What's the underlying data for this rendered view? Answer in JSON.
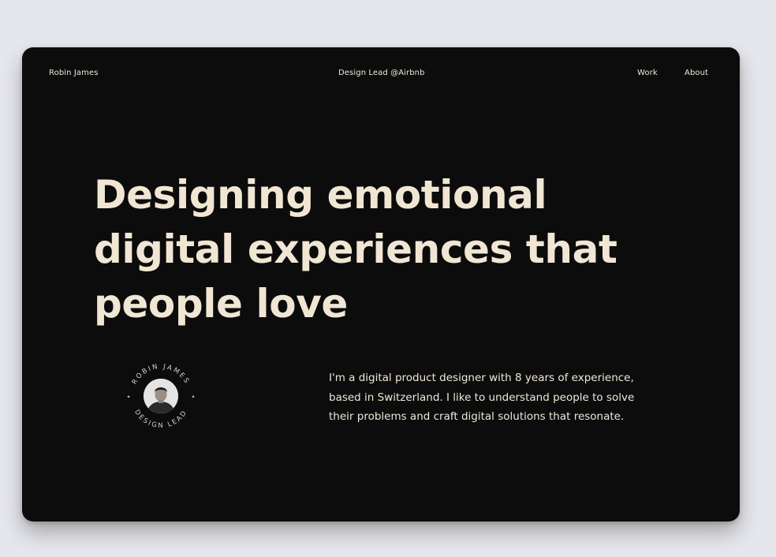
{
  "header": {
    "brand": "Robin James",
    "role": "Design Lead @Airbnb",
    "nav": [
      {
        "label": "Work"
      },
      {
        "label": "About"
      }
    ]
  },
  "hero": {
    "headline_lines": [
      "Designing emotional",
      "digital experiences that",
      "people love"
    ]
  },
  "badge": {
    "ring_text_top": "ROBIN JAMES",
    "ring_text_bottom": "DESIGN LEAD"
  },
  "bio": {
    "lines": [
      "I'm a digital product designer with 8 years of experience,",
      "based in Switzerland. I like to understand people to solve",
      "their problems and craft digital solutions that resonate."
    ]
  },
  "colors": {
    "page_background": "#e6e7ec",
    "card_background": "#0c0c0c",
    "text_cream": "#f1e6d4"
  }
}
